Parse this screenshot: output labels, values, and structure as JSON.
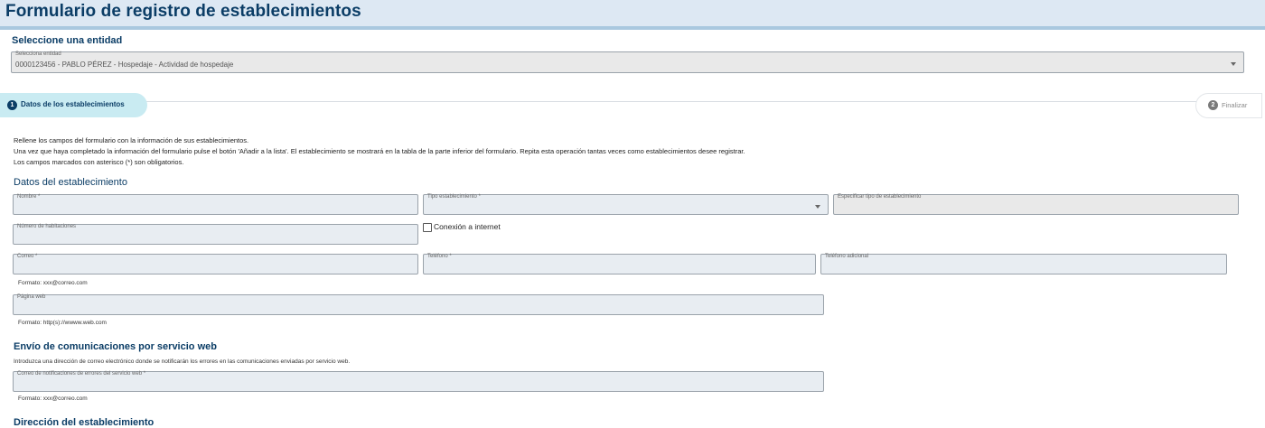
{
  "page": {
    "title": "Formulario de registro de establecimientos"
  },
  "entity": {
    "section_title": "Seleccione una entidad",
    "select_label": "Selecciona entidad",
    "select_value": "0000123456 - PABLO PÉREZ - Hospedaje - Actividad de hospedaje"
  },
  "stepper": {
    "steps": [
      {
        "number": "1",
        "label": "Datos de los establecimientos"
      },
      {
        "number": "2",
        "label": "Finalizar"
      }
    ]
  },
  "intro": {
    "lines": [
      "Rellene los campos del formulario con la información de sus establecimientos.",
      "Una vez que haya completado la información del formulario pulse el botón 'Añadir a la lista'. El establecimiento se mostrará en la tabla de la parte inferior del formulario. Repita esta operación tantas veces como establecimientos desee registrar.",
      "Los campos marcados con asterisco (*) son obligatorios."
    ]
  },
  "establishment": {
    "section_title": "Datos del establecimiento",
    "nombre_label": "Nombre *",
    "tipo_label": "Tipo establecimiento *",
    "especificar_label": "Especificar tipo de establecimiento",
    "habitaciones_label": "Número de habitaciones",
    "internet_label": "Conexión a internet",
    "correo_label": "Correo *",
    "telefono_label": "Teléfono *",
    "telefono_adicional_label": "Teléfono adicional",
    "correo_hint": "Formato: xxx@correo.com",
    "web_label": "Página web",
    "web_hint": "Formato: http(s)://wwww.web.com"
  },
  "webservice": {
    "section_title": "Envío de comunicaciones por servicio web",
    "description": "Introduzca una dirección de correo electrónico donde se notificarán los errores en las comunicaciones enviadas por servicio web.",
    "email_label": "Correo de notificaciones de errores del servicio web *",
    "email_hint": "Formato: xxx@correo.com"
  },
  "address": {
    "section_title": "Dirección del establecimiento"
  },
  "colors": {
    "primary": "#0b3d66",
    "header_bg": "#dde8f3",
    "active_step_bg": "#c9ebf2"
  }
}
